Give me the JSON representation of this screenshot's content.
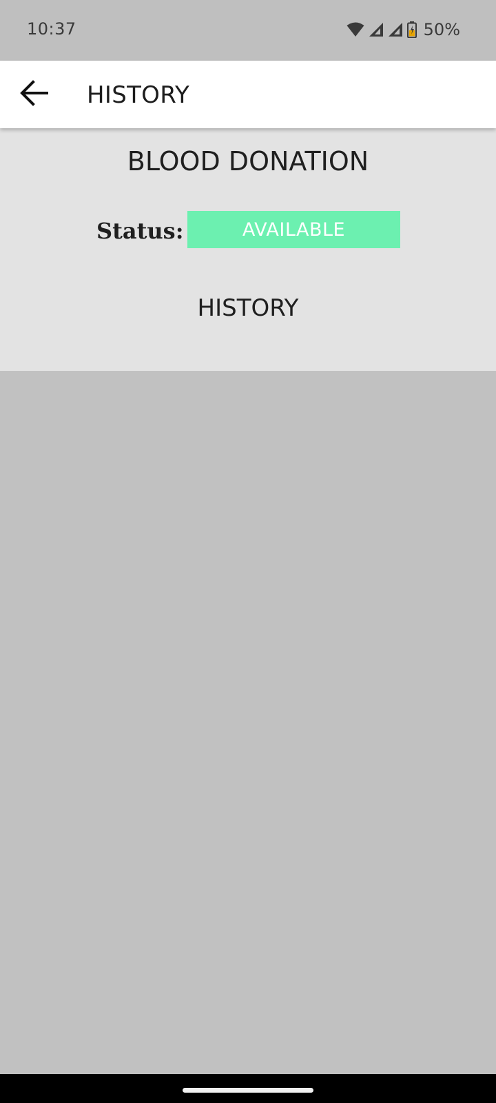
{
  "status_bar": {
    "time": "10:37",
    "battery": "50%",
    "icons": [
      "wifi-icon",
      "signal-icon",
      "signal-icon",
      "battery-icon"
    ]
  },
  "app_bar": {
    "back_icon": "arrow-back-icon",
    "title": "HISTORY"
  },
  "main": {
    "section_title": "BLOOD DONATION",
    "status_label": "Status:",
    "status_value": "AVAILABLE",
    "history_label": "HISTORY"
  },
  "colors": {
    "status_bar_bg": "#bfbfbf",
    "app_bar_bg": "#ffffff",
    "panel_bg": "#e3e3e3",
    "body_bg": "#c1c1c1",
    "status_badge_bg": "#6cf0b0",
    "nav_bar_bg": "#000000"
  }
}
